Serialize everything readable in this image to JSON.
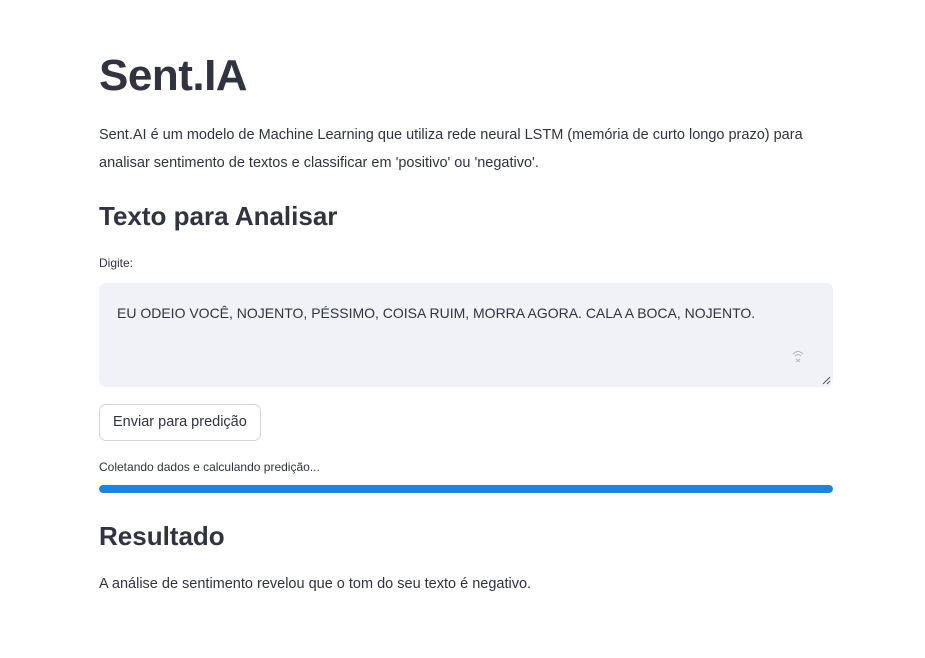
{
  "app": {
    "title": "Sent.IA",
    "description": "Sent.AI é um modelo de Machine Learning que utiliza rede neural LSTM (memória de curto longo prazo) para analisar sentimento de textos e classificar em 'positivo' ou 'negativo'."
  },
  "input_section": {
    "heading": "Texto para Analisar",
    "field_label": "Digite:",
    "text_value": "EU ODEIO VOCÊ, NOJENTO, PÉSSIMO, COISA RUIM, MORRA AGORA. CALA A BOCA, NOJENTO.",
    "extension_icon": "grammar-extension-icon",
    "submit_label": "Enviar para predição"
  },
  "progress": {
    "label": "Coletando dados e calculando predição...",
    "value_percent": 100,
    "color": "#1c83e1"
  },
  "result_section": {
    "heading": "Resultado",
    "text": "A análise de sentimento revelou que o tom do seu texto é negativo."
  },
  "colors": {
    "text": "#31333f",
    "input_background": "#f0f2f6",
    "accent": "#1c83e1",
    "button_border": "#d6d6d9"
  }
}
